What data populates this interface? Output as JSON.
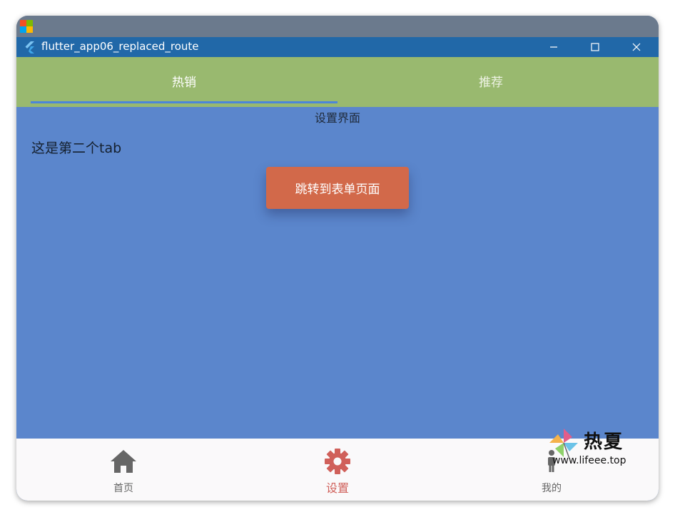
{
  "window": {
    "title": "flutter_app06_replaced_route"
  },
  "tabs": [
    {
      "label": "热销",
      "active": true
    },
    {
      "label": "推荐",
      "active": false
    }
  ],
  "page": {
    "title": "设置界面",
    "tab_text": "这是第二个tab"
  },
  "button": {
    "label": "跳转到表单页面"
  },
  "bottom_nav": [
    {
      "label": "首页",
      "icon": "home-icon",
      "selected": false
    },
    {
      "label": "设置",
      "icon": "gear-icon",
      "selected": true
    },
    {
      "label": "我的",
      "icon": "person-icon",
      "selected": false
    }
  ],
  "watermark": {
    "text": "热夏",
    "url": "www.lifeee.top"
  },
  "colors": {
    "appbar": "#99b96f",
    "body": "#5b86cc",
    "titlebar": "#2168a8",
    "button": "#d2694a",
    "selected_nav": "#d0605a",
    "unselected_nav": "#666666"
  }
}
